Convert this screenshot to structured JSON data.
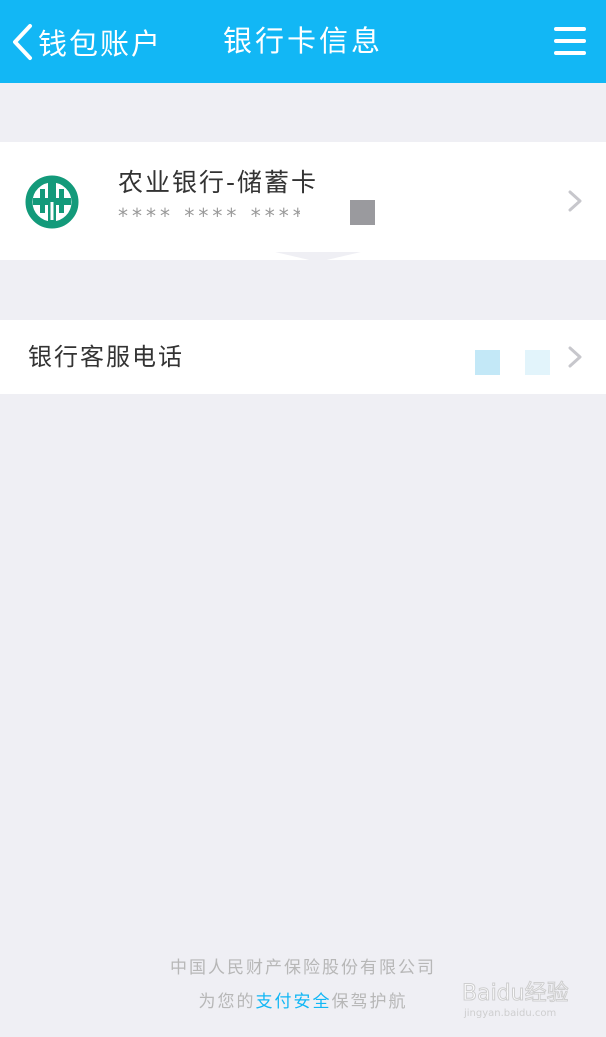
{
  "navbar": {
    "back_label": "钱包账户",
    "title": "银行卡信息",
    "bg_color": "#12b7f5",
    "menu_icon": "hamburger-menu-icon"
  },
  "card": {
    "bank_logo": "agricultural-bank-logo",
    "name": "农业银行-储蓄卡",
    "number_masked": "**** **** ****",
    "logo_color": "#139a7a"
  },
  "service": {
    "label": "银行客服电话"
  },
  "footer": {
    "line1": "中国人民财产保险股份有限公司",
    "line2_prefix": "为您的",
    "line2_highlight": "支付安全",
    "line2_suffix": "保驾护航"
  },
  "watermark": {
    "brand": "Baidu经验",
    "url": "jingyan.baidu.com"
  }
}
